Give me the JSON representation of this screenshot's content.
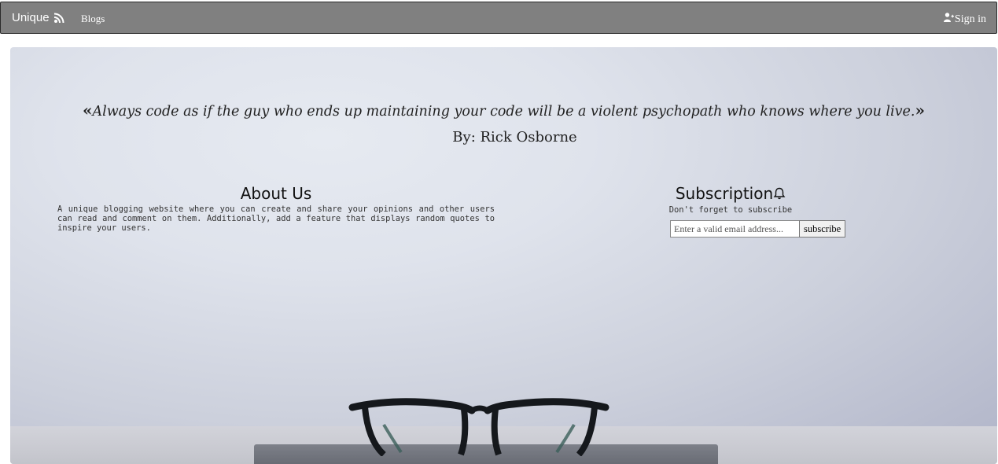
{
  "navbar": {
    "brand": "Unique",
    "brand_icon": "rss-icon",
    "links": [
      {
        "label": "Blogs"
      }
    ],
    "signin": {
      "label": "Sign in",
      "icon": "user-plus-icon"
    }
  },
  "hero": {
    "quote": {
      "open_mark": "«",
      "text": "Always code as if the guy who ends up maintaining your code will be a violent psychopath who knows where you live.",
      "close_mark": "»",
      "author": "By: Rick Osborne"
    },
    "about": {
      "title": "About Us",
      "text": "A unique blogging website where you can create and share your opinions and other users can read and comment on them. Additionally, add a feature that displays random quotes to inspire your users."
    },
    "subscription": {
      "title": "Subscription",
      "title_icon": "bell-icon",
      "subtitle": "Don't forget to subscribe",
      "email_placeholder": "Enter a valid email address...",
      "button_label": "subscribe"
    }
  },
  "colors": {
    "navbar_bg": "#808080",
    "navbar_text": "#ffffff",
    "hero_bg": "#dfe3ec"
  }
}
